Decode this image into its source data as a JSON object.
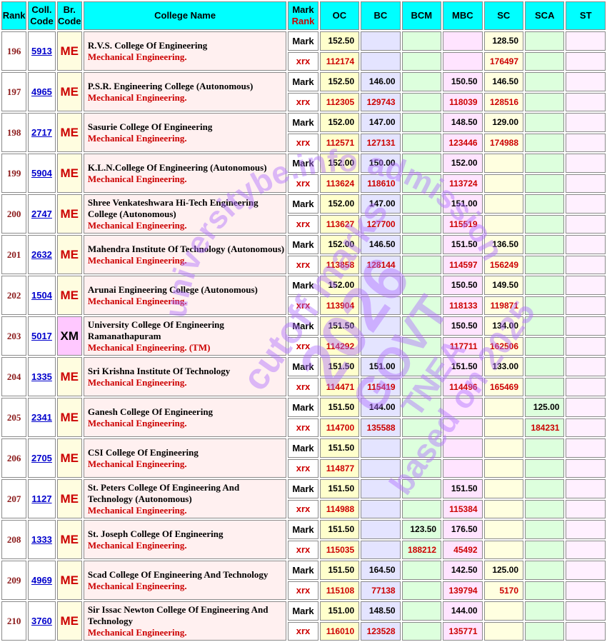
{
  "headers": {
    "rank": "Rank",
    "coll_code": "Coll. Code",
    "br_code": "Br. Code",
    "college_name": "College Name",
    "mark": "Mark",
    "rank_sub": "Rank",
    "categories": [
      "OC",
      "BC",
      "BCM",
      "MBC",
      "SC",
      "SCA",
      "ST"
    ]
  },
  "row_labels": {
    "mark": "Mark",
    "rank": "xrx"
  },
  "rows": [
    {
      "rank": "196",
      "code": "5913",
      "branch": "ME",
      "name": "R.V.S. College Of Engineering",
      "branch_name": "Mechanical Engineering.",
      "marks": [
        "152.50",
        "",
        "",
        "",
        "128.50",
        "",
        ""
      ],
      "ranks": [
        "112174",
        "",
        "",
        "",
        "176497",
        "",
        ""
      ]
    },
    {
      "rank": "197",
      "code": "4965",
      "branch": "ME",
      "name": "P.S.R. Engineering College (Autonomous)",
      "branch_name": "Mechanical Engineering.",
      "marks": [
        "152.50",
        "146.00",
        "",
        "150.50",
        "146.50",
        "",
        ""
      ],
      "ranks": [
        "112305",
        "129743",
        "",
        "118039",
        "128516",
        "",
        ""
      ]
    },
    {
      "rank": "198",
      "code": "2717",
      "branch": "ME",
      "name": "Sasurie College Of Engineering",
      "branch_name": "Mechanical Engineering.",
      "marks": [
        "152.00",
        "147.00",
        "",
        "148.50",
        "129.00",
        "",
        ""
      ],
      "ranks": [
        "112571",
        "127131",
        "",
        "123446",
        "174988",
        "",
        ""
      ]
    },
    {
      "rank": "199",
      "code": "5904",
      "branch": "ME",
      "name": "K.L.N.College Of Engineering (Autonomous)",
      "branch_name": "Mechanical Engineering.",
      "marks": [
        "152.00",
        "150.00",
        "",
        "152.00",
        "",
        "",
        ""
      ],
      "ranks": [
        "113624",
        "118610",
        "",
        "113724",
        "",
        "",
        ""
      ]
    },
    {
      "rank": "200",
      "code": "2747",
      "branch": "ME",
      "name": "Shree Venkateshwara Hi-Tech Engineering College (Autonomous)",
      "branch_name": "Mechanical Engineering.",
      "marks": [
        "152.00",
        "147.00",
        "",
        "151.00",
        "",
        "",
        ""
      ],
      "ranks": [
        "113627",
        "127700",
        "",
        "115519",
        "",
        "",
        ""
      ]
    },
    {
      "rank": "201",
      "code": "2632",
      "branch": "ME",
      "name": "Mahendra Institute Of Technology (Autonomous)",
      "branch_name": "Mechanical Engineering.",
      "marks": [
        "152.00",
        "146.50",
        "",
        "151.50",
        "136.50",
        "",
        ""
      ],
      "ranks": [
        "113858",
        "128144",
        "",
        "114597",
        "156249",
        "",
        ""
      ]
    },
    {
      "rank": "202",
      "code": "1504",
      "branch": "ME",
      "name": "Arunai Engineering College (Autonomous)",
      "branch_name": "Mechanical Engineering.",
      "marks": [
        "152.00",
        "",
        "",
        "150.50",
        "149.50",
        "",
        ""
      ],
      "ranks": [
        "113904",
        "",
        "",
        "118133",
        "119871",
        "",
        ""
      ]
    },
    {
      "rank": "203",
      "code": "5017",
      "branch": "XM",
      "name": "University College Of Engineering Ramanathapuram",
      "branch_name": "Mechanical Engineering. (TM)",
      "marks": [
        "151.50",
        "",
        "",
        "150.50",
        "134.00",
        "",
        ""
      ],
      "ranks": [
        "114292",
        "",
        "",
        "117711",
        "162506",
        "",
        ""
      ]
    },
    {
      "rank": "204",
      "code": "1335",
      "branch": "ME",
      "name": "Sri Krishna Institute Of Technology",
      "branch_name": "Mechanical Engineering.",
      "marks": [
        "151.50",
        "151.00",
        "",
        "151.50",
        "133.00",
        "",
        ""
      ],
      "ranks": [
        "114471",
        "115419",
        "",
        "114496",
        "165469",
        "",
        ""
      ]
    },
    {
      "rank": "205",
      "code": "2341",
      "branch": "ME",
      "name": "Ganesh College Of Engineering",
      "branch_name": "Mechanical Engineering.",
      "marks": [
        "151.50",
        "144.00",
        "",
        "",
        "",
        "125.00",
        ""
      ],
      "ranks": [
        "114700",
        "135588",
        "",
        "",
        "",
        "184231",
        ""
      ]
    },
    {
      "rank": "206",
      "code": "2705",
      "branch": "ME",
      "name": "CSI College Of Engineering",
      "branch_name": "Mechanical Engineering.",
      "marks": [
        "151.50",
        "",
        "",
        "",
        "",
        "",
        ""
      ],
      "ranks": [
        "114877",
        "",
        "",
        "",
        "",
        "",
        ""
      ]
    },
    {
      "rank": "207",
      "code": "1127",
      "branch": "ME",
      "name": "St. Peters College Of Engineering And Technology (Autonomous)",
      "branch_name": "Mechanical Engineering.",
      "marks": [
        "151.50",
        "",
        "",
        "151.50",
        "",
        "",
        ""
      ],
      "ranks": [
        "114988",
        "",
        "",
        "115384",
        "",
        "",
        ""
      ]
    },
    {
      "rank": "208",
      "code": "1333",
      "branch": "ME",
      "name": "St. Joseph College Of Engineering",
      "branch_name": "Mechanical Engineering.",
      "marks": [
        "151.50",
        "",
        "123.50",
        "176.50",
        "",
        "",
        ""
      ],
      "ranks": [
        "115035",
        "",
        "188212",
        "45492",
        "",
        "",
        ""
      ]
    },
    {
      "rank": "209",
      "code": "4969",
      "branch": "ME",
      "name": "Scad College Of Engineering And Technology",
      "branch_name": "Mechanical Engineering.",
      "marks": [
        "151.50",
        "164.50",
        "",
        "142.50",
        "125.00",
        "",
        ""
      ],
      "ranks": [
        "115108",
        "77138",
        "",
        "139794",
        "5170",
        "",
        ""
      ]
    },
    {
      "rank": "210",
      "code": "3760",
      "branch": "ME",
      "name": "Sir Issac Newton College Of Engineering And Technology",
      "branch_name": "Mechanical Engineering.",
      "marks": [
        "151.00",
        "148.50",
        "",
        "144.00",
        "",
        "",
        ""
      ],
      "ranks": [
        "116010",
        "123528",
        "",
        "135771",
        "",
        "",
        ""
      ]
    }
  ],
  "watermark": {
    "arc_text": "universitybe.info admission",
    "line1": "cutoff marks",
    "line2": "2026",
    "line3": "GOVT",
    "line4": "TNEA",
    "line5": "based on 2025",
    "color": "#b070ff"
  }
}
